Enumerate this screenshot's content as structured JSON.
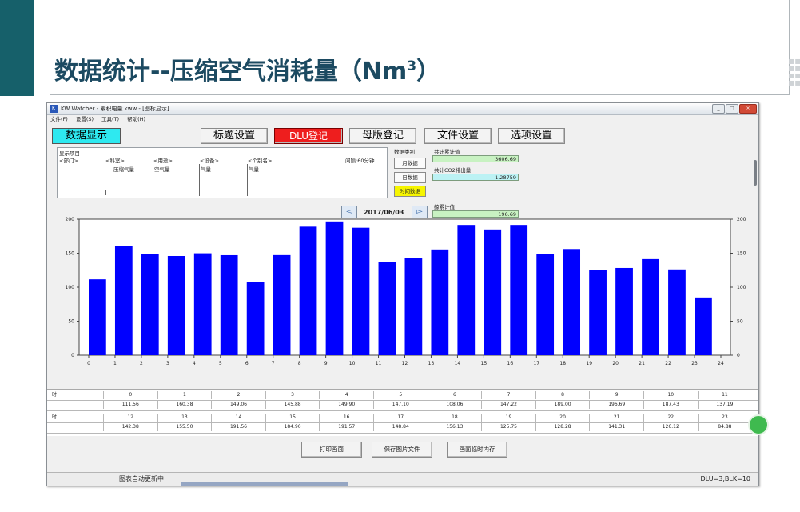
{
  "slide": {
    "title": "数据统计--压缩空气消耗量（Nm",
    "title_sup": "3",
    "title_close": "）"
  },
  "window": {
    "title": "KW Watcher - 累积电量.kww - [图标显示]",
    "min": "_",
    "max": "□",
    "close": "×"
  },
  "menu": [
    "文件(F)",
    "设置(S)",
    "工具(T)",
    "帮助(H)"
  ],
  "toolbar": {
    "display_btn": "数据显示",
    "buttons": [
      "标题设置",
      "DLU登记",
      "母版登记",
      "文件设置",
      "选项设置"
    ]
  },
  "info": {
    "section_label": "显示项目",
    "col_headers": [
      "<部门>",
      "<科室>",
      "<用途>",
      "<设备>",
      "<个别名>"
    ],
    "interval": "间隔:60分钟",
    "col_values": [
      "压缩气量",
      "空气量",
      "气量",
      "气量"
    ]
  },
  "category": {
    "label": "数据类别",
    "buttons": [
      "月数据",
      "日数据",
      "时间数据"
    ]
  },
  "totals": {
    "total_label": "共计累计值",
    "total_value": "3606.69",
    "co2_label": "共计CO2排出量",
    "co2_value": "1.28759",
    "cum_label": "鲸累计值",
    "cum_value": "196.69"
  },
  "nav": {
    "prev_icon": "◅",
    "next_icon": "▻",
    "date": "2017/06/03"
  },
  "chart_data": {
    "type": "bar",
    "categories": [
      "0",
      "1",
      "2",
      "3",
      "4",
      "5",
      "6",
      "7",
      "8",
      "9",
      "10",
      "11",
      "12",
      "13",
      "14",
      "15",
      "16",
      "17",
      "18",
      "19",
      "20",
      "21",
      "22",
      "23",
      "24"
    ],
    "values": [
      111.56,
      160.38,
      149.06,
      145.88,
      149.9,
      147.1,
      108.06,
      147.22,
      189.0,
      196.69,
      187.43,
      137.19,
      142.38,
      155.5,
      191.56,
      184.9,
      191.57,
      148.84,
      156.13,
      125.75,
      128.28,
      141.31,
      126.12,
      84.88
    ],
    "ylim": [
      0,
      200
    ],
    "yticks": [
      "0",
      "50",
      "100",
      "150",
      "200"
    ],
    "bar_color": "#0000ff",
    "grid": false
  },
  "table": {
    "row_header": "时",
    "hours_top": [
      "0",
      "1",
      "2",
      "3",
      "4",
      "5",
      "6",
      "7",
      "8",
      "9",
      "10",
      "11"
    ],
    "values_top": [
      "111.56",
      "160.38",
      "149.06",
      "145.88",
      "149.90",
      "147.10",
      "108.06",
      "147.22",
      "189.00",
      "196.69",
      "187.43",
      "137.19"
    ],
    "hours_bottom": [
      "12",
      "13",
      "14",
      "15",
      "16",
      "17",
      "18",
      "19",
      "20",
      "21",
      "22",
      "23"
    ],
    "values_bottom": [
      "142.38",
      "155.50",
      "191.56",
      "184.90",
      "191.57",
      "148.84",
      "156.13",
      "125.75",
      "128.28",
      "141.31",
      "126.12",
      "84.88"
    ]
  },
  "bottom_buttons": [
    "打印画面",
    "保存图片文件",
    "画面临时内存"
  ],
  "status": {
    "left": "图表自动更新中",
    "right": "DLU=3,BLK=10"
  }
}
